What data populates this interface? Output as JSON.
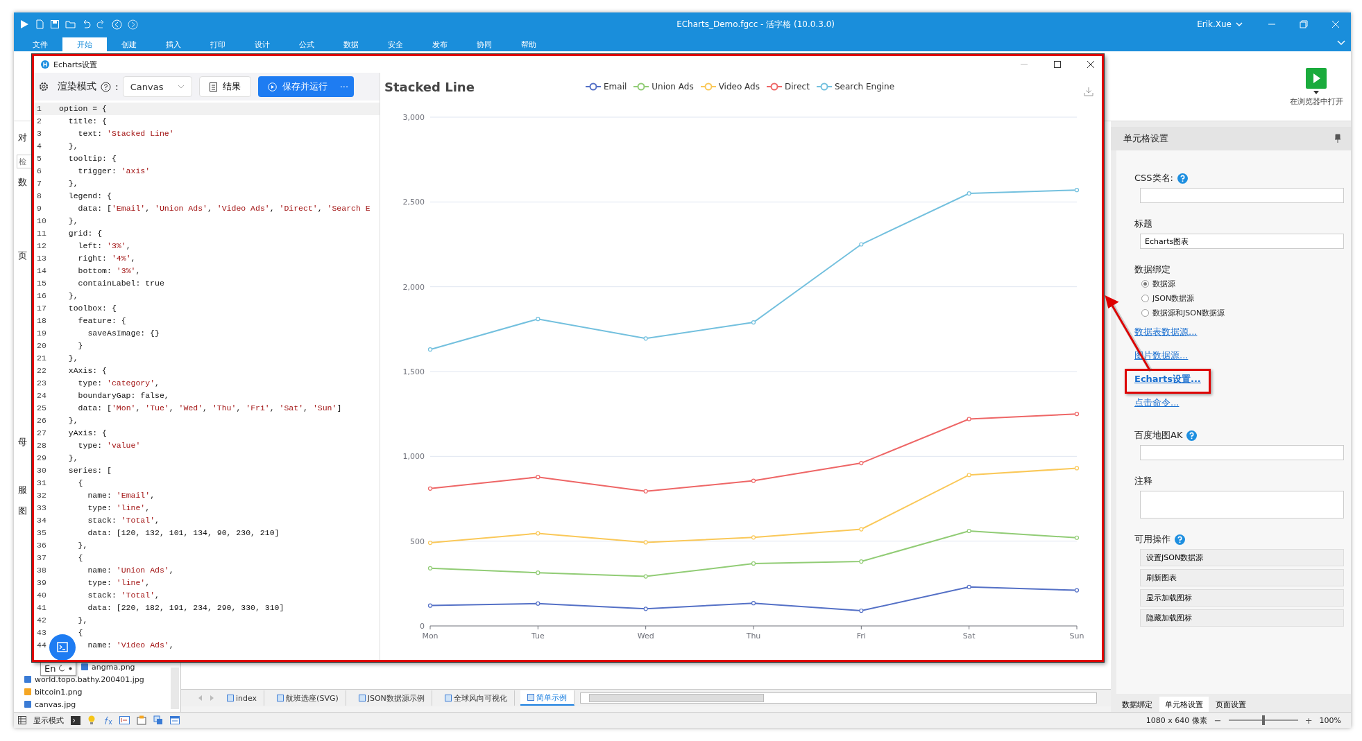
{
  "window": {
    "title": "ECharts_Demo.fgcc - 活字格 (10.0.3.0)",
    "user": "Erik.Xue"
  },
  "ribbon_tabs": [
    {
      "label": "文件",
      "selected": false
    },
    {
      "label": "开始",
      "selected": true
    },
    {
      "label": "创建",
      "selected": false
    },
    {
      "label": "插入",
      "selected": false
    },
    {
      "label": "打印",
      "selected": false
    },
    {
      "label": "设计",
      "selected": false
    },
    {
      "label": "公式",
      "selected": false
    },
    {
      "label": "数据",
      "selected": false
    },
    {
      "label": "安全",
      "selected": false
    },
    {
      "label": "发布",
      "selected": false
    },
    {
      "label": "协同",
      "selected": false
    },
    {
      "label": "帮助",
      "selected": false
    }
  ],
  "run_button": {
    "label": "在浏览器中打开"
  },
  "sidebar": {
    "fragments": [
      "对",
      "数",
      "页",
      "母",
      "服",
      "图"
    ],
    "search": {
      "placeholder": "检"
    },
    "files": [
      {
        "name": "angma.png",
        "color": "#3a7bd5"
      },
      {
        "name": "world.topo.bathy.200401.jpg",
        "color": "#3a7bd5"
      },
      {
        "name": "bitcoin1.png",
        "color": "#f5a623"
      },
      {
        "name": "canvas.jpg",
        "color": "#3a7bd5"
      }
    ],
    "ime": {
      "label": "En"
    }
  },
  "dialog": {
    "title": "Echarts设置",
    "annotated": true,
    "toolbar": {
      "mode_label": "渲染模式",
      "mode_colon": ":",
      "mode_value": "Canvas",
      "result_button": "结果",
      "run_button": "保存并运行",
      "more": "···"
    },
    "code_lines": [
      {
        "n": "1",
        "code": "option = {"
      },
      {
        "n": "2",
        "code": "  title: {"
      },
      {
        "n": "3",
        "code": "    text: 'Stacked Line'"
      },
      {
        "n": "4",
        "code": "  },"
      },
      {
        "n": "5",
        "code": "  tooltip: {"
      },
      {
        "n": "6",
        "code": "    trigger: 'axis'"
      },
      {
        "n": "7",
        "code": "  },"
      },
      {
        "n": "8",
        "code": "  legend: {"
      },
      {
        "n": "9",
        "code": "    data: ['Email', 'Union Ads', 'Video Ads', 'Direct', 'Search E"
      },
      {
        "n": "10",
        "code": "  },"
      },
      {
        "n": "11",
        "code": "  grid: {"
      },
      {
        "n": "12",
        "code": "    left: '3%',"
      },
      {
        "n": "13",
        "code": "    right: '4%',"
      },
      {
        "n": "14",
        "code": "    bottom: '3%',"
      },
      {
        "n": "15",
        "code": "    containLabel: true"
      },
      {
        "n": "16",
        "code": "  },"
      },
      {
        "n": "17",
        "code": "  toolbox: {"
      },
      {
        "n": "18",
        "code": "    feature: {"
      },
      {
        "n": "19",
        "code": "      saveAsImage: {}"
      },
      {
        "n": "20",
        "code": "    }"
      },
      {
        "n": "21",
        "code": "  },"
      },
      {
        "n": "22",
        "code": "  xAxis: {"
      },
      {
        "n": "23",
        "code": "    type: 'category',"
      },
      {
        "n": "24",
        "code": "    boundaryGap: false,"
      },
      {
        "n": "25",
        "code": "    data: ['Mon', 'Tue', 'Wed', 'Thu', 'Fri', 'Sat', 'Sun']"
      },
      {
        "n": "26",
        "code": "  },"
      },
      {
        "n": "27",
        "code": "  yAxis: {"
      },
      {
        "n": "28",
        "code": "    type: 'value'"
      },
      {
        "n": "29",
        "code": "  },"
      },
      {
        "n": "30",
        "code": "  series: ["
      },
      {
        "n": "31",
        "code": "    {"
      },
      {
        "n": "32",
        "code": "      name: 'Email',"
      },
      {
        "n": "33",
        "code": "      type: 'line',"
      },
      {
        "n": "34",
        "code": "      stack: 'Total',"
      },
      {
        "n": "35",
        "code": "      data: [120, 132, 101, 134, 90, 230, 210]"
      },
      {
        "n": "36",
        "code": "    },"
      },
      {
        "n": "37",
        "code": "    {"
      },
      {
        "n": "38",
        "code": "      name: 'Union Ads',"
      },
      {
        "n": "39",
        "code": "      type: 'line',"
      },
      {
        "n": "40",
        "code": "      stack: 'Total',"
      },
      {
        "n": "41",
        "code": "      data: [220, 182, 191, 234, 290, 330, 310]"
      },
      {
        "n": "42",
        "code": "    },"
      },
      {
        "n": "43",
        "code": "    {"
      },
      {
        "n": "44",
        "code": "      name: 'Video Ads',"
      }
    ],
    "chart_data": {
      "type": "line",
      "title": "Stacked Line",
      "grid": true,
      "legend": true,
      "categories": [
        "Mon",
        "Tue",
        "Wed",
        "Thu",
        "Fri",
        "Sat",
        "Sun"
      ],
      "ylim": [
        0,
        3000
      ],
      "yticks": [
        {
          "value": 0,
          "label": "0"
        },
        {
          "value": 500,
          "label": "500"
        },
        {
          "value": 1000,
          "label": "1,000"
        },
        {
          "value": 1500,
          "label": "1,500"
        },
        {
          "value": 2000,
          "label": "2,000"
        },
        {
          "value": 2500,
          "label": "2,500"
        },
        {
          "value": 3000,
          "label": "3,000"
        }
      ],
      "series": [
        {
          "name": "Email",
          "color": "#5470c6",
          "marker": "circle",
          "values": [
            120,
            132,
            101,
            134,
            90,
            230,
            210
          ]
        },
        {
          "name": "Union Ads",
          "color": "#91cc75",
          "marker": "circle",
          "values": [
            340,
            314,
            292,
            368,
            380,
            560,
            520
          ]
        },
        {
          "name": "Video Ads",
          "color": "#fac858",
          "marker": "circle",
          "values": [
            490,
            546,
            493,
            522,
            570,
            890,
            930
          ]
        },
        {
          "name": "Direct",
          "color": "#ee6666",
          "marker": "circle",
          "values": [
            810,
            878,
            794,
            856,
            960,
            1220,
            1250
          ]
        },
        {
          "name": "Search Engine",
          "color": "#73c0de",
          "marker": "circle",
          "values": [
            1630,
            1810,
            1695,
            1790,
            2250,
            2550,
            2570
          ]
        }
      ]
    }
  },
  "cell_settings": {
    "title": "单元格设置",
    "css_label": "CSS类名:",
    "title_label": "标题",
    "title_value": "Echarts图表",
    "binding_label": "数据绑定",
    "binding_options": [
      {
        "label": "数据源",
        "selected": true
      },
      {
        "label": "JSON数据源",
        "selected": false
      },
      {
        "label": "数据源和JSON数据源",
        "selected": false
      }
    ],
    "links": [
      {
        "label": "数据表数据源...",
        "annotated": false
      },
      {
        "label": "图片数据源...",
        "annotated": false
      },
      {
        "label": "Echarts设置...",
        "annotated": true
      },
      {
        "label": "点击命令...",
        "annotated": false
      }
    ],
    "map_label": "百度地图AK",
    "note_label": "注释",
    "actions_label": "可用操作",
    "actions": [
      "设置JSON数据源",
      "刷新图表",
      "显示加载图标",
      "隐藏加载图标"
    ],
    "panel_tabs": [
      {
        "label": "数据绑定",
        "selected": false
      },
      {
        "label": "单元格设置",
        "selected": true
      },
      {
        "label": "页面设置",
        "selected": false
      }
    ]
  },
  "sheet_tabs": [
    {
      "label": "index",
      "selected": false
    },
    {
      "label": "航班选座(SVG)",
      "selected": false
    },
    {
      "label": "JSON数据源示例",
      "selected": false
    },
    {
      "label": "全球风向可视化",
      "selected": false
    },
    {
      "label": "简单示例",
      "selected": true
    }
  ],
  "status_bar": {
    "mode_label": "显示模式",
    "size": "1080 x 640 像素",
    "zoom": {
      "minus": "−",
      "plus": "+",
      "level": 0.5,
      "reading": "100%"
    }
  }
}
